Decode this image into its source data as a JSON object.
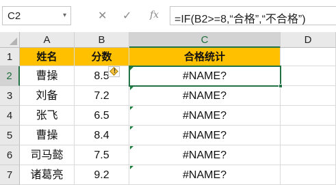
{
  "formula_bar": {
    "name_box": "C2",
    "name_box_dropdown": "▾",
    "cancel": "✕",
    "enter": "✓",
    "fx": "fx",
    "formula": "=IF(B2>=8,“合格”,“不合格”)"
  },
  "columns": [
    "A",
    "B",
    "C",
    "D"
  ],
  "rows": [
    "1",
    "2",
    "3",
    "4",
    "5",
    "6",
    "7"
  ],
  "header_row": {
    "name": "姓名",
    "score": "分数",
    "result": "合格统计"
  },
  "data_rows": [
    {
      "name": "曹操",
      "score": "8.5",
      "result": "#NAME?"
    },
    {
      "name": "刘备",
      "score": "7.2",
      "result": "#NAME?"
    },
    {
      "name": "张飞",
      "score": "6.5",
      "result": "#NAME?"
    },
    {
      "name": "曹操",
      "score": "8.4",
      "result": "#NAME?"
    },
    {
      "name": "司马懿",
      "score": "7.5",
      "result": "#NAME?"
    },
    {
      "name": "诸葛亮",
      "score": "9.2",
      "result": "#NAME?"
    }
  ],
  "colors": {
    "header_fill": "#ffc000",
    "selection": "#217346",
    "error_marker": "#1e7e3e"
  },
  "icons": {
    "error_tag": "warning-diamond-icon"
  }
}
